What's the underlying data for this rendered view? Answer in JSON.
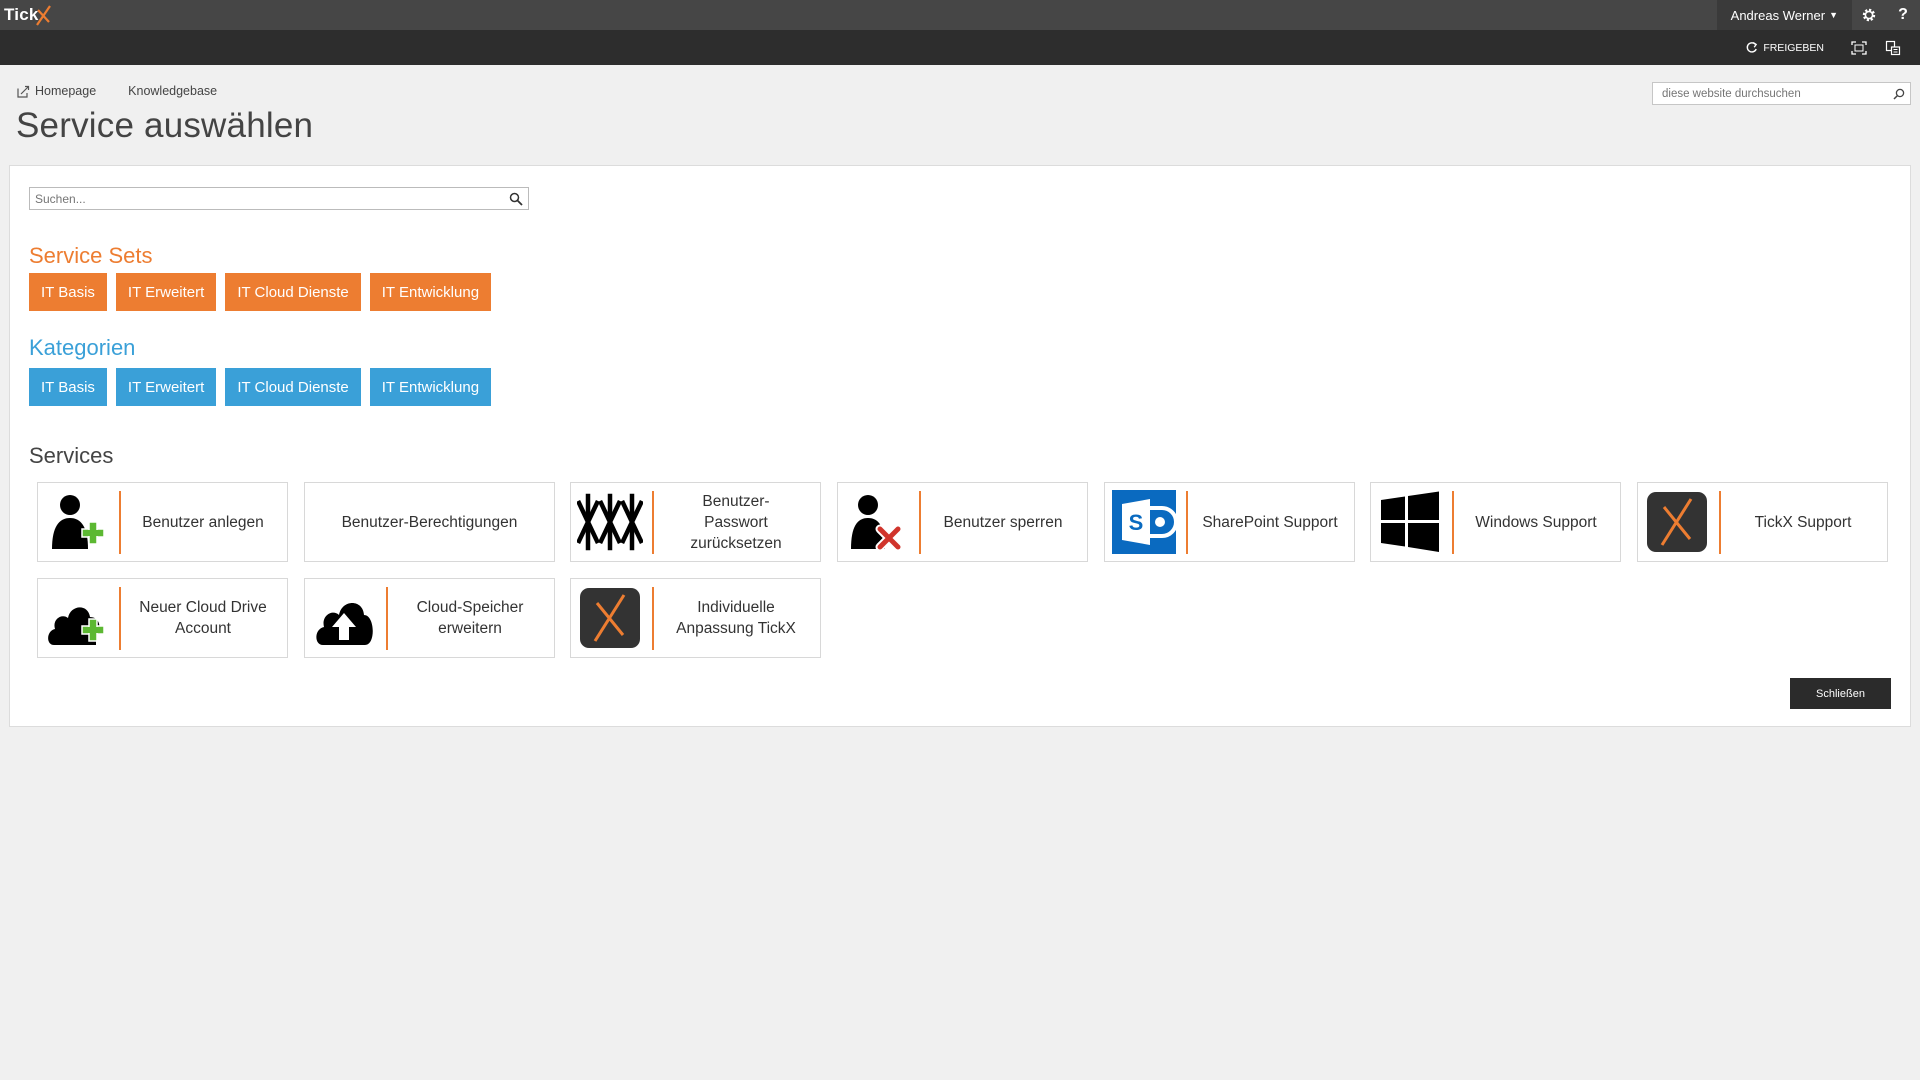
{
  "suitebar": {
    "logo_text": "Tick",
    "user_name": "Andreas Werner",
    "settings_icon": "gear-icon",
    "help_icon": "help-icon",
    "help_glyph": "?",
    "background": "#464646"
  },
  "ribbon": {
    "share_label": "FREIGEBEN",
    "focus_icon": "focus-icon",
    "sync_icon": "sync-icon",
    "background": "#2d2d2d"
  },
  "topnav": {
    "items": [
      {
        "label": "Homepage",
        "icon": "edit-link-icon"
      },
      {
        "label": "Knowledgebase"
      }
    ]
  },
  "site_search": {
    "placeholder": "diese website durchsuchen"
  },
  "page": {
    "title": "Service auswählen"
  },
  "panel": {
    "search_placeholder": "Suchen...",
    "service_sets": {
      "title": "Service Sets",
      "color": "#ed7d31",
      "items": [
        "IT Basis",
        "IT Erweitert",
        "IT Cloud Dienste",
        "IT Entwicklung"
      ]
    },
    "categories": {
      "title": "Kategorien",
      "color": "#3aa0d8",
      "items": [
        "IT Basis",
        "IT Erweitert",
        "IT Cloud Dienste",
        "IT Entwicklung"
      ]
    },
    "services": {
      "title": "Services",
      "items": [
        {
          "label": "Benutzer anlegen",
          "icon": "user-add-icon"
        },
        {
          "label": "Benutzer-Berechtigungen",
          "icon": ""
        },
        {
          "label": "Benutzer-\nPasswort\nzurücksetzen",
          "icon": "password-icon"
        },
        {
          "label": "Benutzer sperren",
          "icon": "user-block-icon"
        },
        {
          "label": "SharePoint Support",
          "icon": "sharepoint-icon"
        },
        {
          "label": "Windows Support",
          "icon": "windows-icon"
        },
        {
          "label": "TickX Support",
          "icon": "tickx-icon"
        },
        {
          "label": "Neuer Cloud Drive\nAccount",
          "icon": "cloud-add-icon"
        },
        {
          "label": "Cloud-Speicher\nerweitern",
          "icon": "cloud-upload-icon"
        },
        {
          "label": "Individuelle\nAnpassung TickX",
          "icon": "tickx-icon"
        }
      ]
    },
    "close_label": "Schließen"
  }
}
